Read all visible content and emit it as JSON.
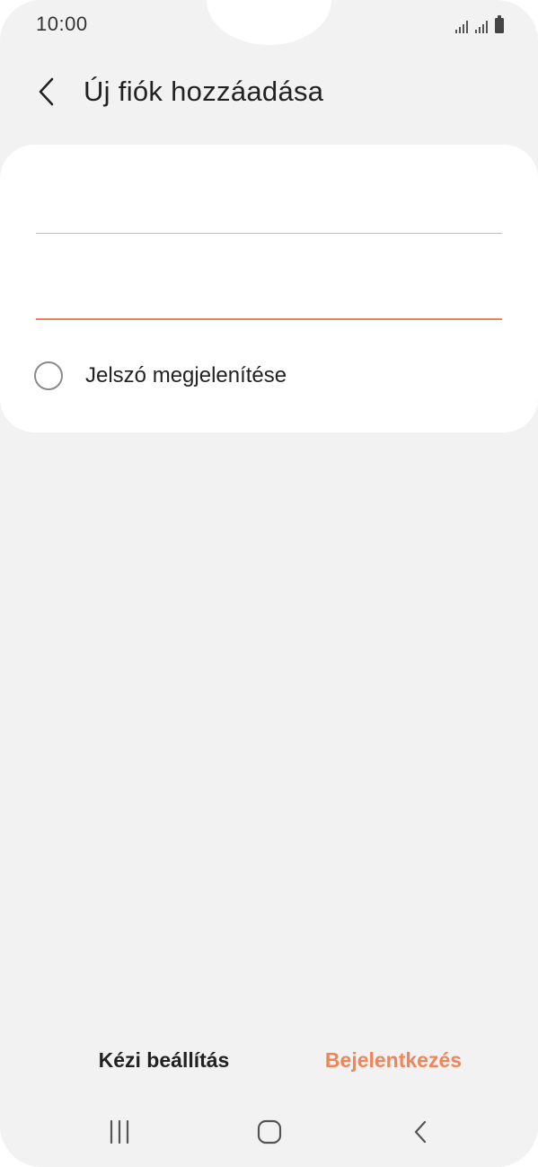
{
  "status_bar": {
    "time": "10:00",
    "icons": [
      "signal-icon",
      "signal-icon",
      "battery-icon"
    ]
  },
  "header": {
    "back_icon": "chevron-left-icon",
    "title": "Új fiók hozzáadása"
  },
  "form": {
    "email": {
      "value": "",
      "placeholder": ""
    },
    "password": {
      "value": "",
      "placeholder": ""
    },
    "show_password_label": "Jelszó megjelenítése",
    "show_password_checked": false
  },
  "actions": {
    "manual_setup_label": "Kézi beállítás",
    "login_label": "Bejelentkezés"
  },
  "nav_bar": {
    "icons": [
      "recent-apps-icon",
      "home-icon",
      "back-icon"
    ]
  },
  "colors": {
    "accent": "#ef8558",
    "background": "#f2f2f2",
    "card": "#ffffff"
  }
}
